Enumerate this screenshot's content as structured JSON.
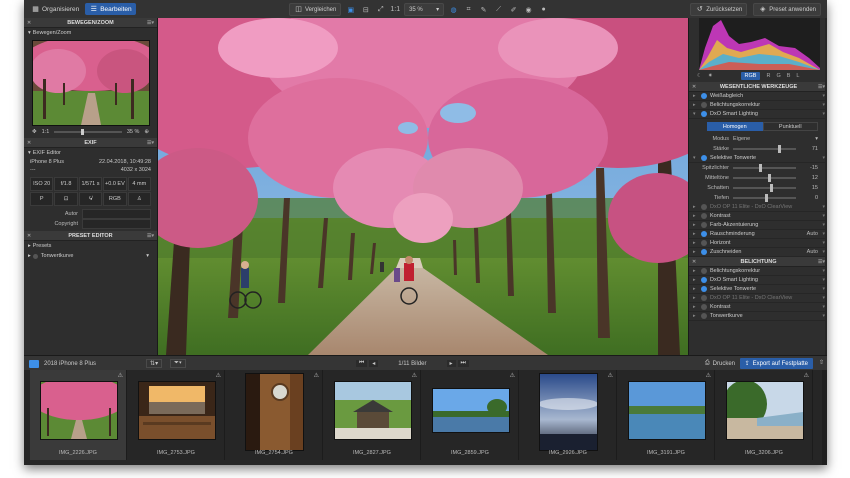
{
  "topbar": {
    "organize": "Organisieren",
    "edit": "Bearbeiten",
    "compare": "Vergleichen",
    "ratio": "1:1",
    "zoom": "35 %",
    "reset": "Zurücksetzen",
    "apply_preset": "Preset anwenden"
  },
  "left": {
    "move_zoom_title": "BEWEGEN/ZOOM",
    "move_zoom_sub": "Bewegen/Zoom",
    "zoom_left": "1:1",
    "zoom_right": "35 %",
    "exif_title": "EXIF",
    "exif_sub": "EXIF Editor",
    "camera": "iPhone 8 Plus",
    "date": "22.04.2018, 10:49:28",
    "dash": "---",
    "size": "4032 x 3024",
    "params": [
      "ISO 20",
      "f/1.8",
      "1/571 s",
      "+0.0 EV",
      "4 mm"
    ],
    "icons": [
      "P",
      "",
      "",
      "RGB",
      ""
    ],
    "author_label": "Autor",
    "copyright_label": "Copyright",
    "preset_title": "PRESET EDITOR",
    "presets_item": "Presets",
    "tone_item": "Tonwertkurve"
  },
  "right": {
    "rgb": "RGB",
    "r": "R",
    "g": "G",
    "b": "B",
    "l": "L",
    "section1": "WESENTLICHE WERKZEUGE",
    "wb": "Weißabgleich",
    "exposure": "Belichtungskorrektur",
    "smart": "DxO Smart Lighting",
    "homogen": "Homogen",
    "punktuell": "Punktuell",
    "modus_label": "Modus",
    "modus_val": "Eigene",
    "staerke_label": "Stärke",
    "staerke_val": "71",
    "selective": "Selektive Tonwerte",
    "spitz_label": "Spitzlichter",
    "spitz_val": "-15",
    "mittel_label": "Mitteltöne",
    "mittel_val": "12",
    "schatten_label": "Schatten",
    "schatten_val": "15",
    "tiefen_label": "Tiefen",
    "tiefen_val": "0",
    "clearview": "DxO OP 11 Elite - DxO ClearView",
    "kontrast": "Kontrast",
    "farb": "Farb-Akzentuierung",
    "rausch": "Rauschminderung",
    "rausch_val": "Auto",
    "horizont": "Horizont",
    "zuschneiden": "Zuschneiden",
    "zuschneiden_val": "Auto",
    "section2": "BELICHTUNG",
    "b_exposure": "Belichtungskorrektur",
    "b_smart": "DxO Smart Lighting",
    "b_selective": "Selektive Tonwerte",
    "b_clearview": "DxO OP 11 Elite - DxO ClearView",
    "b_kontrast": "Kontrast",
    "b_tonwert": "Tonwertkurve"
  },
  "filmbar": {
    "folder": "2018 iPhone 8 Plus",
    "count": "1/11 Bilder",
    "print": "Drucken",
    "export": "Export auf Festplatte"
  },
  "thumbs": [
    "IMG_2226.JPG",
    "IMG_2753.JPG",
    "IMG_2754.JPG",
    "IMG_2827.JPG",
    "IMG_2859.JPG",
    "IMG_2926.JPG",
    "IMG_3191.JPG",
    "IMG_3206.JPG"
  ],
  "colors": {
    "accent": "#2a5ea8",
    "blossom": "#d9608e"
  }
}
